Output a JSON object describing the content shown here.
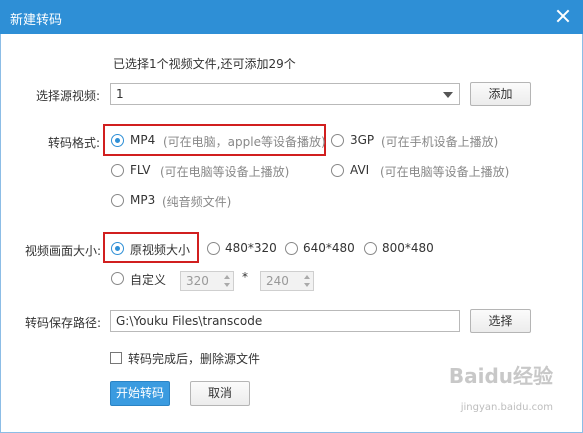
{
  "window": {
    "title": "新建转码"
  },
  "info": {
    "selected_text": "已选择1个视频文件,还可添加29个"
  },
  "source": {
    "label": "选择源视频:",
    "value": "1",
    "add_button": "添加"
  },
  "format": {
    "label": "转码格式:",
    "options": [
      {
        "name": "MP4",
        "hint": "(可在电脑，apple等设备播放)",
        "selected": true
      },
      {
        "name": "3GP",
        "hint": "(可在手机设备上播放)",
        "selected": false
      },
      {
        "name": "FLV",
        "hint": "(可在电脑等设备上播放)",
        "selected": false
      },
      {
        "name": "AVI",
        "hint": "(可在电脑等设备上播放)",
        "selected": false
      },
      {
        "name": "MP3",
        "hint": "(纯音频文件)",
        "selected": false
      }
    ]
  },
  "size": {
    "label": "视频画面大小:",
    "options": [
      {
        "name": "原视频大小",
        "selected": true
      },
      {
        "name": "480*320",
        "selected": false
      },
      {
        "name": "640*480",
        "selected": false
      },
      {
        "name": "800*480",
        "selected": false
      },
      {
        "name": "自定义",
        "selected": false
      }
    ],
    "custom_width": "320",
    "custom_height": "240",
    "times_sign": "*"
  },
  "save": {
    "label": "转码保存路径:",
    "path": "G:\\Youku Files\\transcode",
    "select_button": "选择"
  },
  "delete_source": {
    "label": "转码完成后，删除源文件",
    "checked": false
  },
  "actions": {
    "start": "开始转码",
    "cancel": "取消"
  },
  "watermark": {
    "text": "Baidu经验",
    "url": "jingyan.baidu.com"
  },
  "colors": {
    "titlebar": "#2e8fd6",
    "highlight": "#d11f1f",
    "primary_button": "#3a9be0"
  }
}
